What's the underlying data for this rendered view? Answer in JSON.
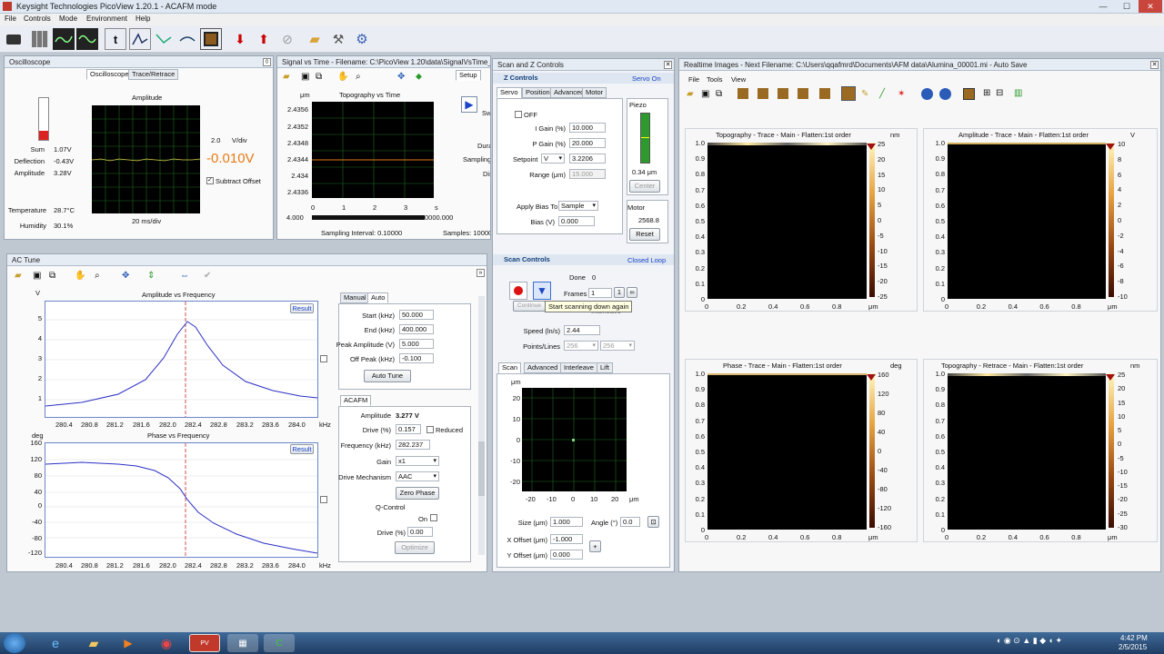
{
  "window": {
    "title": "Keysight Technologies PicoView 1.20.1 - ACAFM mode",
    "min": "—",
    "max": "☐",
    "close": "✕"
  },
  "menu": [
    "File",
    "Controls",
    "Mode",
    "Environment",
    "Help"
  ],
  "oscilloscope": {
    "title": "Oscilloscope",
    "tabs": [
      "Oscilloscope",
      "Trace/Retrace"
    ],
    "plot_title": "Amplitude",
    "readings": [
      {
        "label": "Sum",
        "value": "1.07V"
      },
      {
        "label": "Deflection",
        "value": "-0.43V"
      },
      {
        "label": "Amplitude",
        "value": "3.28V"
      }
    ],
    "env": [
      {
        "label": "Temperature",
        "value": "28.7°C"
      },
      {
        "label": "Humidity",
        "value": "30.1%"
      }
    ],
    "scale": "2.0",
    "scale_unit": "V/div",
    "big_value": "-0.010V",
    "subtract_offset": "Subtract Offset",
    "time_div": "20 ms/div"
  },
  "signal": {
    "title": "Signal vs Time - Filename: C:\\PicoView 1.20\\data\\SignalVsTime_<",
    "plot_title": "Topography  vs  Time",
    "yunit": "μm",
    "yticks": [
      "2.4356",
      "2.4352",
      "2.4348",
      "2.4344",
      "2.434",
      "2.4336"
    ],
    "xticks": [
      "0",
      "1",
      "2",
      "3"
    ],
    "xunit": "s",
    "range_left": "4.000",
    "range_right": "0000.000",
    "sampling": "Sampling Interval: 0.10000",
    "samples": "Samples: 100000",
    "setup_tab": "Setup",
    "sw": "Sw",
    "dura": "Dura",
    "sampf": "Sampling F",
    "dis": "Dis"
  },
  "zcontrols": {
    "window_title": "Scan and Z Controls",
    "header": "Z Controls",
    "status": "Servo On",
    "tabs": [
      "Servo",
      "Position",
      "Advanced",
      "Motor"
    ],
    "off": "OFF",
    "fields": [
      {
        "label": "I Gain (%)",
        "value": "10.000"
      },
      {
        "label": "P Gain (%)",
        "value": "20.000"
      }
    ],
    "setpoint_label": "Setpoint",
    "setpoint_unit": "V",
    "setpoint": "3.2206",
    "range_label": "Range (μm)",
    "range": "15.000",
    "apply_bias_label": "Apply Bias To",
    "apply_bias": "Sample",
    "bias_label": "Bias (V)",
    "bias": "0.000",
    "piezo": "Piezo",
    "piezo_value": "0.34 μm",
    "center": "Center",
    "motor": "Motor",
    "motor_value": "2568.8",
    "reset": "Reset"
  },
  "scancontrols": {
    "header": "Scan Controls",
    "status": "Closed Loop",
    "done_label": "Done",
    "done": "0",
    "frames_label": "Frames",
    "frames": "1",
    "continue": "Continue",
    "interleave_hint": "Interleave",
    "tooltip": "Start scanning down again",
    "speed_label": "Speed (ln/s)",
    "speed": "2.44",
    "points_label": "Points/Lines",
    "points": "256",
    "lines": "256",
    "tabs": [
      "Scan",
      "Advanced",
      "Interleave",
      "Lift"
    ],
    "plot_unit": "μm",
    "yticks": [
      "20",
      "10",
      "0",
      "-10",
      "-20"
    ],
    "xticks": [
      "-20",
      "-10",
      "0",
      "10",
      "20"
    ],
    "size_label": "Size (μm)",
    "size": "1.000",
    "angle_label": "Angle (°)",
    "angle": "0.0",
    "xoff_label": "X Offset (μm)",
    "xoff": "-1.000",
    "yoff_label": "Y Offset (μm)",
    "yoff": "0.000"
  },
  "actune": {
    "title": "AC Tune",
    "amp_title": "Amplitude  vs  Frequency",
    "amp_unit": "V",
    "amp_yticks": [
      "5",
      "4",
      "3",
      "2",
      "1"
    ],
    "phase_title": "Phase  vs  Frequency",
    "phase_unit": "deg",
    "phase_yticks": [
      "160",
      "120",
      "80",
      "40",
      "0",
      "-40",
      "-80",
      "-120"
    ],
    "xticks": [
      "280.4",
      "280.8",
      "281.2",
      "281.6",
      "282.0",
      "282.4",
      "282.8",
      "283.2",
      "283.6",
      "284.0"
    ],
    "xunit": "kHz",
    "result": "Result",
    "tabs": [
      "Manual",
      "Auto"
    ],
    "auto_fields": [
      {
        "label": "Start (kHz)",
        "value": "50.000"
      },
      {
        "label": "End (kHz)",
        "value": "400.000"
      },
      {
        "label": "Peak Amplitude (V)",
        "value": "5.000"
      },
      {
        "label": "Off Peak (kHz)",
        "value": "-0.100"
      }
    ],
    "auto_tune": "Auto Tune",
    "acafm_tab": "ACAFM",
    "amplitude_label": "Amplitude",
    "amplitude": "3.277 V",
    "drive_label": "Drive (%)",
    "drive": "0.157",
    "reduced": "Reduced",
    "freq_label": "Frequency (kHz)",
    "freq": "282.237",
    "gain_label": "Gain",
    "gain": "x1",
    "mech_label": "Drive Mechanism",
    "mech": "AAC",
    "zero_phase": "Zero Phase",
    "qcontrol": "Q-Control",
    "on": "On",
    "qdrive_label": "Drive (%)",
    "qdrive": "0.00",
    "optimize": "Optimize"
  },
  "realtime": {
    "title": "Realtime Images - Next Filename: C:\\Users\\qqafmrd\\Documents\\AFM data\\Alumina_00001.mi - Auto Save",
    "menu": [
      "File",
      "Tools",
      "View"
    ],
    "images": [
      {
        "title": "Topography - Trace - Main - Flatten:1st order",
        "unit": "nm",
        "ticks": [
          "25",
          "20",
          "15",
          "10",
          "5",
          "0",
          "-5",
          "-10",
          "-15",
          "-20",
          "-25"
        ]
      },
      {
        "title": "Amplitude - Trace - Main - Flatten:1st order",
        "unit": "V",
        "ticks": [
          "10",
          "8",
          "6",
          "4",
          "2",
          "0",
          "-2",
          "-4",
          "-6",
          "-8",
          "-10"
        ]
      },
      {
        "title": "Phase - Trace - Main - Flatten:1st order",
        "unit": "deg",
        "ticks": [
          "160",
          "120",
          "80",
          "40",
          "0",
          "-40",
          "-80",
          "-120",
          "-160"
        ]
      },
      {
        "title": "Topography - Retrace - Main - Flatten:1st order",
        "unit": "nm",
        "ticks": [
          "25",
          "20",
          "15",
          "10",
          "5",
          "0",
          "-5",
          "-10",
          "-15",
          "-20",
          "-25",
          "-30"
        ]
      }
    ],
    "yticks": [
      "1.0",
      "0.9",
      "0.8",
      "0.7",
      "0.6",
      "0.5",
      "0.4",
      "0.3",
      "0.2",
      "0.1",
      "0"
    ],
    "xticks": [
      "0",
      "0.2",
      "0.4",
      "0.6",
      "0.8"
    ],
    "xunit": "μm"
  },
  "taskbar": {
    "time": "4:42 PM",
    "date": "2/5/2015"
  }
}
